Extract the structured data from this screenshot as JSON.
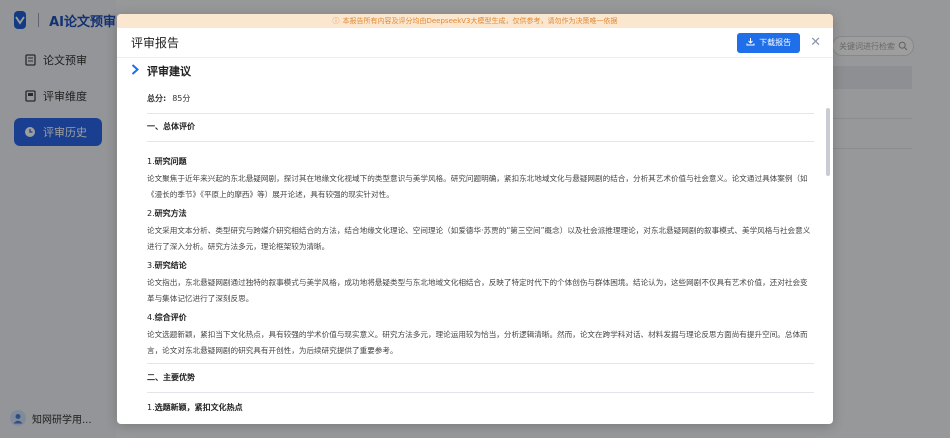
{
  "app": {
    "title": "AI论文预审"
  },
  "sidebar": {
    "items": [
      {
        "label": "论文预审",
        "active": false,
        "icon": "document-icon"
      },
      {
        "label": "评审维度",
        "active": false,
        "icon": "dimension-icon"
      },
      {
        "label": "评审历史",
        "active": true,
        "icon": "clock-icon"
      }
    ],
    "user": "知网研学用..."
  },
  "background": {
    "search_placeholder": "关键词进行检索"
  },
  "modal": {
    "notice": "本报告所有内容及评分均由DeepseekV3大模型生成，仅供参考，请勿作为决策唯一依据",
    "title": "评审报告",
    "download_label": "下载报告",
    "section_title": "评审建议",
    "score_label": "总分:",
    "score_value": "85分",
    "h_overall": "一、总体评价",
    "items": [
      {
        "num": "1.",
        "title": "研究问题",
        "text": "论文聚焦于近年来兴起的东北悬疑网剧，探讨其在地缘文化视域下的类型意识与美学风格。研究问题明确，紧扣东北地域文化与悬疑网剧的结合，分析其艺术价值与社会意义。论文通过具体案例（如《漫长的季节》《平原上的摩西》等）展开论述，具有较强的现实针对性。"
      },
      {
        "num": "2.",
        "title": "研究方法",
        "text": "论文采用文本分析、类型研究与跨媒介研究相结合的方法，结合地缘文化理论、空间理论（如爱德华·苏贾的“第三空间”概念）以及社会派推理理论，对东北悬疑网剧的叙事模式、美学风格与社会意义进行了深入分析。研究方法多元，理论框架较为清晰。"
      },
      {
        "num": "3.",
        "title": "研究结论",
        "text": "论文指出，东北悬疑网剧通过独特的叙事模式与美学风格，成功地将悬疑类型与东北地域文化相结合，反映了特定时代下的个体创伤与群体困境。结论认为，这些网剧不仅具有艺术价值，还对社会变革与集体记忆进行了深刻反思。"
      },
      {
        "num": "4.",
        "title": "综合评价",
        "text": "论文选题新颖，紧扣当下文化热点，具有较强的学术价值与现实意义。研究方法多元，理论运用较为恰当，分析逻辑清晰。然而，论文在跨学科对话、材料发掘与理论反思方面尚有提升空间。总体而言，论文对东北悬疑网剧的研究具有开创性，为后续研究提供了重要参考。"
      }
    ],
    "h_advantages": "二、主要优势",
    "adv_item": {
      "num": "1.",
      "title": "选题新颖，紧扣文化热点"
    }
  }
}
